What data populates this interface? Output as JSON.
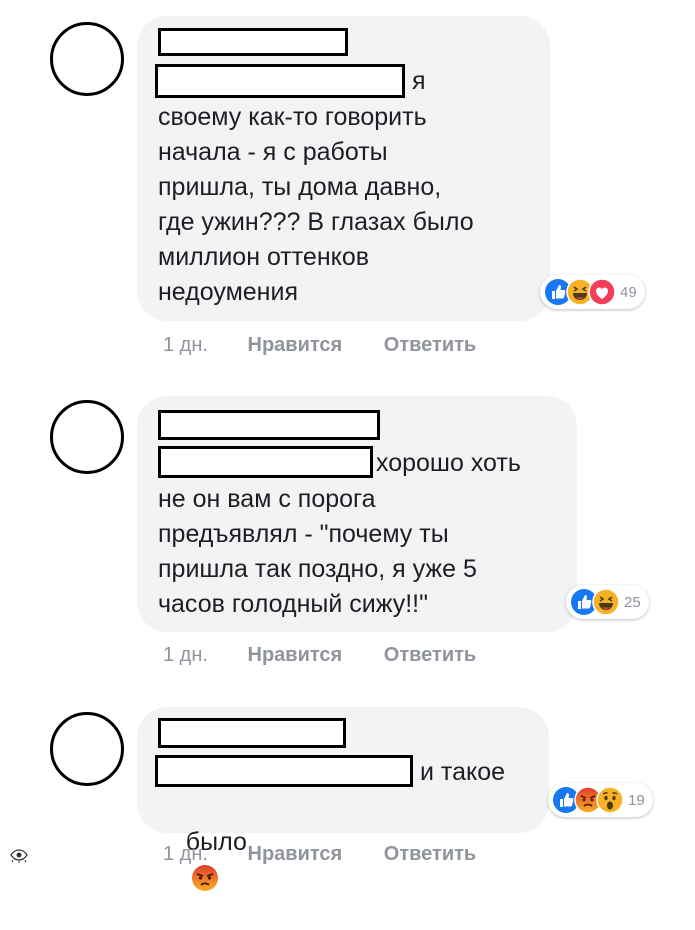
{
  "comments": [
    {
      "text_line1_suffix": "я",
      "text_lines": [
        "своему как-то говорить",
        "начала - я с работы",
        "пришла, ты дома давно,",
        "где ужин??? В глазах было",
        "миллион оттенков",
        "недоумения"
      ],
      "reactions": [
        "like",
        "haha",
        "love"
      ],
      "reaction_count": "49",
      "time": "1 дн.",
      "like_label": "Нравится",
      "reply_label": "Ответить"
    },
    {
      "text_line1_suffix": "хорошо хоть",
      "text_lines": [
        "не он вам с порога",
        "предъявлял - \"почему ты",
        "пришла так поздно, я уже 5",
        "часов голодный сижу!!\""
      ],
      "reactions": [
        "like",
        "haha"
      ],
      "reaction_count": "25",
      "time": "1 дн.",
      "like_label": "Нравится",
      "reply_label": "Ответить"
    },
    {
      "text_line1_suffix": "и такое",
      "text_lines": [
        "было"
      ],
      "inline_emoji": "angry-face",
      "reactions": [
        "like",
        "angry",
        "wow"
      ],
      "reaction_count": "19",
      "time": "1 дн.",
      "like_label": "Нравится",
      "reply_label": "Ответить"
    }
  ],
  "colors": {
    "bubble": "#f2f3f5",
    "like": "#1877f2",
    "love": "#f33e58",
    "haha": "#f7b125",
    "angry": "#e9710f",
    "meta_text": "#90949c"
  },
  "watermark_icon": "eye-logo-icon"
}
